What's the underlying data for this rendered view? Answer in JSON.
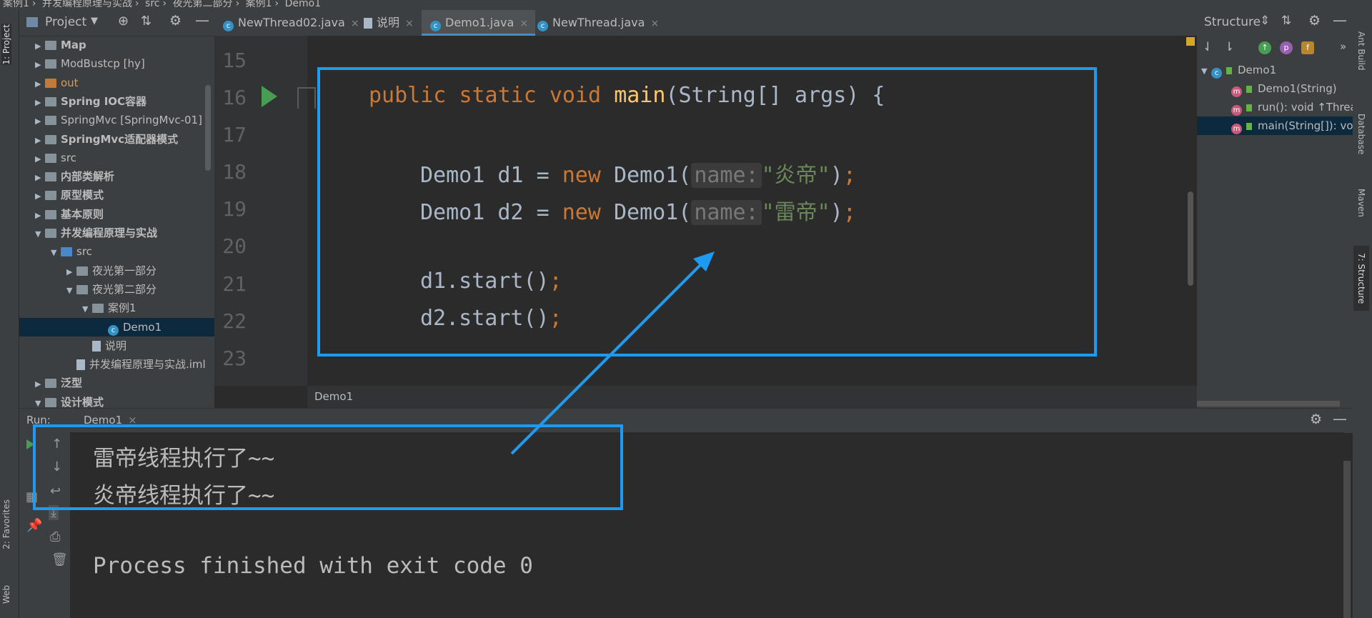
{
  "breadcrumb": [
    "案例1",
    "并发编程原理与实战",
    "src",
    "夜光第二部分",
    "案例1",
    "Demo1"
  ],
  "left_strip": {
    "project_tab": "1: Project",
    "favorites_tab": "2: Favorites",
    "web_tab": "Web"
  },
  "project": {
    "title": "Project",
    "tree": [
      {
        "label": "Map",
        "bold": true,
        "expanded": false,
        "depth": 0,
        "icon": "module"
      },
      {
        "label": "ModBustcp [hy]",
        "bold": false,
        "expanded": false,
        "depth": 0,
        "icon": "module"
      },
      {
        "label": "out",
        "bold": false,
        "expanded": false,
        "depth": 0,
        "icon": "excluded-folder"
      },
      {
        "label": "Spring IOC容器",
        "bold": true,
        "expanded": false,
        "depth": 0,
        "icon": "module"
      },
      {
        "label": "SpringMvc [SpringMvc-01]",
        "bold": false,
        "expanded": false,
        "depth": 0,
        "icon": "module"
      },
      {
        "label": "SpringMvc适配器模式",
        "bold": true,
        "expanded": false,
        "depth": 0,
        "icon": "module"
      },
      {
        "label": "src",
        "bold": false,
        "expanded": false,
        "depth": 0,
        "icon": "folder"
      },
      {
        "label": "内部类解析",
        "bold": true,
        "expanded": false,
        "depth": 0,
        "icon": "module"
      },
      {
        "label": "原型模式",
        "bold": true,
        "expanded": false,
        "depth": 0,
        "icon": "module"
      },
      {
        "label": "基本原则",
        "bold": true,
        "expanded": false,
        "depth": 0,
        "icon": "module"
      },
      {
        "label": "并发编程原理与实战",
        "bold": true,
        "expanded": true,
        "depth": 0,
        "icon": "module"
      },
      {
        "label": "src",
        "bold": false,
        "expanded": true,
        "depth": 1,
        "icon": "source-folder"
      },
      {
        "label": "夜光第一部分",
        "bold": false,
        "expanded": false,
        "depth": 2,
        "icon": "package"
      },
      {
        "label": "夜光第二部分",
        "bold": false,
        "expanded": true,
        "depth": 2,
        "icon": "package"
      },
      {
        "label": "案例1",
        "bold": false,
        "expanded": true,
        "depth": 3,
        "icon": "package"
      },
      {
        "label": "Demo1",
        "bold": false,
        "expanded": null,
        "depth": 4,
        "icon": "class",
        "selected": true
      },
      {
        "label": "说明",
        "bold": false,
        "expanded": null,
        "depth": 3,
        "icon": "file"
      },
      {
        "label": "并发编程原理与实战.iml",
        "bold": false,
        "expanded": null,
        "depth": 2,
        "icon": "file"
      },
      {
        "label": "泛型",
        "bold": true,
        "expanded": false,
        "depth": 0,
        "icon": "module"
      },
      {
        "label": "设计模式",
        "bold": true,
        "expanded": true,
        "depth": 0,
        "icon": "module"
      }
    ]
  },
  "tabs": [
    {
      "label": "NewThread02.java",
      "active": false,
      "icon": "class-icon"
    },
    {
      "label": "说明",
      "active": false,
      "icon": "file-icon"
    },
    {
      "label": "Demo1.java",
      "active": true,
      "icon": "class-icon"
    },
    {
      "label": "NewThread.java",
      "active": false,
      "icon": "class-icon"
    }
  ],
  "editor": {
    "line_numbers": [
      "15",
      "16",
      "17",
      "18",
      "19",
      "20",
      "21",
      "22",
      "23"
    ],
    "code": {
      "kw_public": "public",
      "kw_static": "static",
      "kw_void": "void",
      "method": "main",
      "params": "(String[] args) {",
      "decl_type": "Demo1",
      "d1_name": "d1",
      "d2_name": "d2",
      "assign": "=",
      "kw_new": "new",
      "ctor": "Demo1(",
      "hint": "name:",
      "str1": "\"炎帝\"",
      "str2": "\"雷帝\"",
      "close": ")",
      "semi": ";",
      "start1": "d1.start()",
      "start2": "d2.start()"
    },
    "file_breadcrumb": "Demo1"
  },
  "structure": {
    "title": "Structure",
    "items": [
      {
        "label": "Demo1",
        "kind": "class",
        "depth": 0
      },
      {
        "label": "Demo1(String)",
        "kind": "method",
        "depth": 1
      },
      {
        "label": "run(): void ↑Thread",
        "kind": "method",
        "depth": 1
      },
      {
        "label": "main(String[]): void",
        "kind": "method",
        "depth": 1,
        "selected": true
      }
    ],
    "toolbar_badges": [
      "p",
      "f"
    ]
  },
  "right_strip": {
    "ant": "Ant Build",
    "database": "Database",
    "maven": "Maven",
    "structure": "7: Structure"
  },
  "run": {
    "label": "Run:",
    "tab": "Demo1",
    "output": [
      "雷帝线程执行了~~",
      "炎帝线程执行了~~",
      "",
      "Process finished with exit code 0"
    ]
  },
  "colors": {
    "highlight": "#1e9bf0",
    "keyword": "#cc7832",
    "string": "#6a8759",
    "method": "#ffc66d"
  }
}
